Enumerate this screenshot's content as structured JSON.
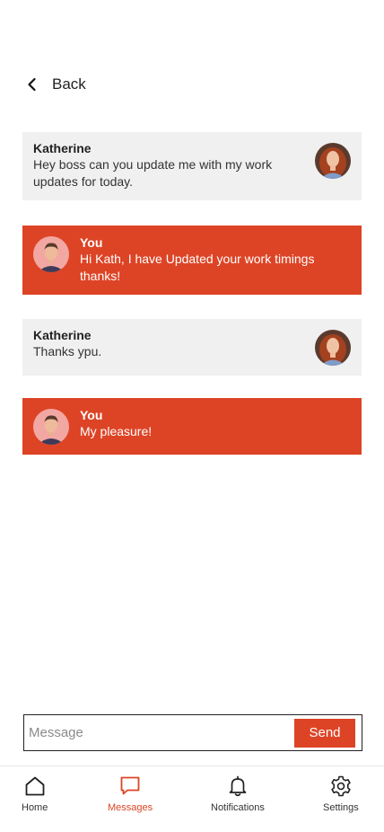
{
  "header": {
    "back_label": "Back"
  },
  "messages": [
    {
      "sender": "Katherine",
      "text": "Hey boss can you update me with my work updates for today."
    },
    {
      "sender": "You",
      "text": "Hi Kath, I have Updated your work timings thanks!"
    },
    {
      "sender": "Katherine",
      "text": "Thanks ypu."
    },
    {
      "sender": "You",
      "text": "My pleasure!"
    }
  ],
  "composer": {
    "placeholder": "Message",
    "value": "",
    "send_label": "Send"
  },
  "tabs": [
    {
      "label": "Home",
      "icon": "home-icon",
      "active": false
    },
    {
      "label": "Messages",
      "icon": "chat-bubble-icon",
      "active": true
    },
    {
      "label": "Notifications",
      "icon": "bell-icon",
      "active": false
    },
    {
      "label": "Settings",
      "icon": "gear-icon",
      "active": false
    }
  ],
  "colors": {
    "accent": "#dd4426",
    "incoming_bg": "#f0f0f0",
    "text": "#222222"
  }
}
